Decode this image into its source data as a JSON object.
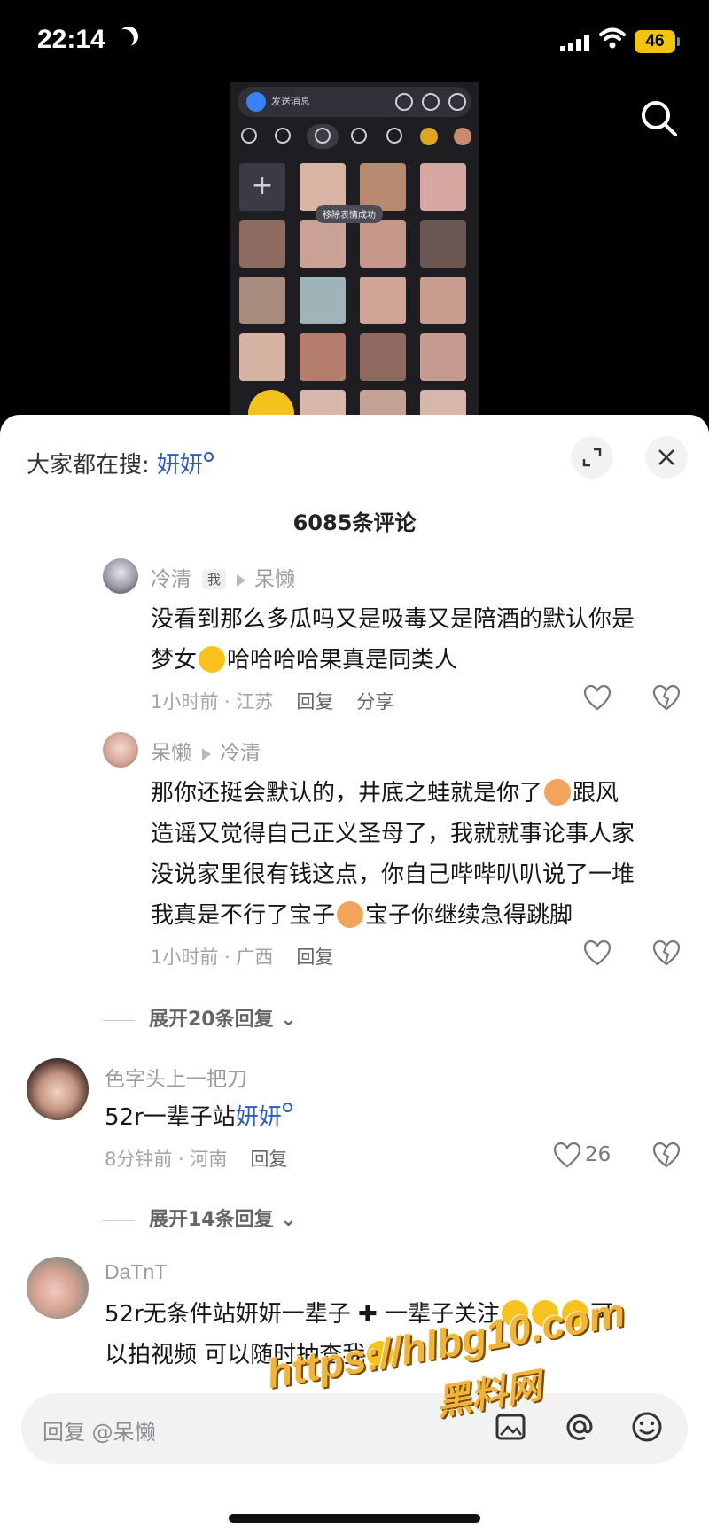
{
  "status_bar": {
    "time": "22:14",
    "battery": "46"
  },
  "video": {
    "send_label": "发送消息",
    "toast": "移除表情成功",
    "add_symbol": "+"
  },
  "sheet": {
    "hot_search_label": "大家都在搜:",
    "hot_search_term": "妍妍",
    "comment_count": "6085条评论"
  },
  "comments": [
    {
      "user": "冷清",
      "badge": "我",
      "reply_to": "呆懒",
      "text_a": "没看到那么多瓜吗又是吸毒又是陪酒的默认你是",
      "text_b1": "梦女",
      "text_b2": "哈哈哈哈果真是同类人",
      "time_loc": "1小时前 · 江苏",
      "reply": "回复",
      "share": "分享"
    },
    {
      "user": "呆懒",
      "reply_to": "冷清",
      "line1a": "那你还挺会默认的，井底之蛙就是你了",
      "line1b": "跟风",
      "line2": "造谣又觉得自己正义圣母了，我就就事论事人家",
      "line3": "没说家里很有钱这点，你自己哔哔叭叭说了一堆",
      "line4a": "我真是不行了宝子",
      "line4b": "宝子你继续急得跳脚",
      "time_loc": "1小时前 · 广西",
      "reply": "回复"
    },
    {
      "user": "色字头上一把刀",
      "text_a": "52r一辈子站",
      "text_link": "妍妍",
      "time_loc": "8分钟前 · 河南",
      "reply": "回复",
      "likes": "26"
    },
    {
      "user": "DaTnT",
      "line1a": "52r无条件站妍妍一辈子",
      "line1b": "一辈子关注",
      "line1c": "可",
      "line2": "以拍视频 可以随时抽查我"
    }
  ],
  "expand_1": "展开20条回复",
  "expand_2": "展开14条回复",
  "input": {
    "placeholder": "回复 @呆懒"
  },
  "watermark": {
    "url": "https://hlbg10.com",
    "name": "黑料网"
  },
  "colors": {
    "link": "#2d5bb9",
    "emoji_yellow": "#f7c21e",
    "watermark": "#f0b43a"
  }
}
